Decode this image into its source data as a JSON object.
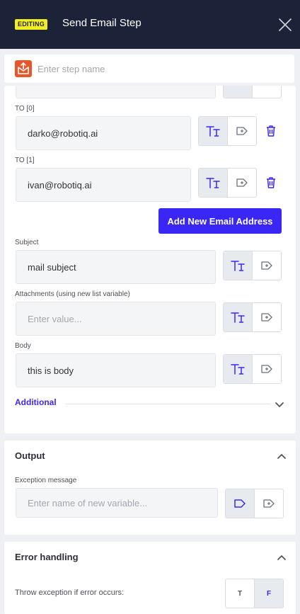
{
  "header": {
    "badge": "EDITING",
    "title": "Send Email Step"
  },
  "step_name": {
    "placeholder": "Enter step name",
    "value": ""
  },
  "to_fields": [
    {
      "label": "TO [0]",
      "value": "darko@robotiq.ai"
    },
    {
      "label": "TO [1]",
      "value": "ivan@robotiq.ai"
    }
  ],
  "add_email_button": "Add New Email Address",
  "subject": {
    "label": "Subject",
    "value": "mail subject"
  },
  "attachments": {
    "label": "Attachments (using new list variable)",
    "placeholder": "Enter value..."
  },
  "body": {
    "label": "Body",
    "value": "this is body"
  },
  "additional": {
    "label": "Additional"
  },
  "output": {
    "title": "Output",
    "exception_label": "Exception message",
    "exception_placeholder": "Enter name of new variable..."
  },
  "error_handling": {
    "title": "Error handling",
    "throw_label": "Throw exception if error occurs:",
    "options": [
      "T",
      "F"
    ],
    "selected": "F"
  },
  "colors": {
    "accent": "#3b27f5",
    "header_bg": "#1c2338",
    "badge": "#f3ee1f",
    "step_icon": "#e8562a"
  }
}
